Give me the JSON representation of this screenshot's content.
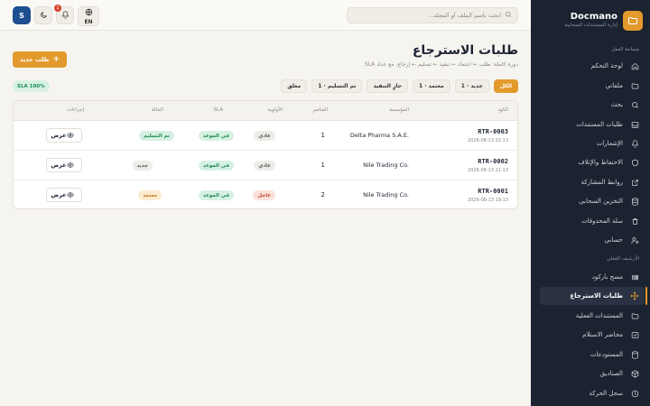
{
  "brand": {
    "name": "Docmano",
    "subtitle": "إدارة المستندات السحابية"
  },
  "sidebar": {
    "workspace_label": "مساحة العمل",
    "archive_label": "الأرشيف الفعلي",
    "items": [
      {
        "label": "لوحة التحكم",
        "icon": "home-icon"
      },
      {
        "label": "ملفاتي",
        "icon": "folder-icon"
      },
      {
        "label": "بحث",
        "icon": "search-icon"
      },
      {
        "label": "طلبات المستندات",
        "icon": "inbox-icon"
      },
      {
        "label": "الإشعارات",
        "icon": "bell-icon"
      },
      {
        "label": "الاحتفاظ والإتلاف",
        "icon": "shield-icon"
      },
      {
        "label": "روابط المشاركة",
        "icon": "external-link-icon"
      },
      {
        "label": "التخزين السحابي",
        "icon": "database-icon"
      },
      {
        "label": "سلة المحذوفات",
        "icon": "trash-icon"
      },
      {
        "label": "حسابي",
        "icon": "user-cog-icon"
      }
    ],
    "archive_items": [
      {
        "label": "مسح باركود",
        "icon": "barcode-icon"
      },
      {
        "label": "طلبات الاسترجاع",
        "icon": "move-icon",
        "active": true
      },
      {
        "label": "المستندات الفعلية",
        "icon": "folder-icon"
      },
      {
        "label": "محاضر الاستلام",
        "icon": "checklist-icon"
      },
      {
        "label": "المستودعات",
        "icon": "warehouse-icon"
      },
      {
        "label": "الصناديق",
        "icon": "box-icon"
      },
      {
        "label": "سجل الحركة",
        "icon": "clock-icon"
      }
    ]
  },
  "topbar": {
    "search_placeholder": "ابحث باسم الملف أو المجلد...",
    "language": "EN",
    "notification_count": "1",
    "avatar_initial": "S"
  },
  "page": {
    "title": "طلبات الاسترجاع",
    "subtitle": "دورة كاملة: طلب ← اعتماد ← تنفيذ ← تسليم ← إرجاع، مع عداد SLA",
    "new_button": "طلب جديد",
    "sla_label": "SLA 100%"
  },
  "filters": [
    {
      "label": "الكل",
      "active": true
    },
    {
      "label": "جديد · 1"
    },
    {
      "label": "معتمد · 1"
    },
    {
      "label": "جارٍ التنفيذ"
    },
    {
      "label": "تم التسليم · 1"
    },
    {
      "label": "مغلق"
    }
  ],
  "table": {
    "headers": {
      "code": "الكود",
      "org": "المؤسسة",
      "items": "العناصر",
      "priority": "الأولوية",
      "sla": "SLA",
      "status": "الحالة",
      "actions": "إجراءات"
    },
    "rows": [
      {
        "code": "RTR-0003",
        "date": "2026-08-13 22:13",
        "org": "Delta Pharma S.A.E.",
        "items": "1",
        "priority": "عادي",
        "priority_type": "normal",
        "sla": "في الموعد",
        "status": "تم التسليم",
        "status_type": "delivered",
        "action": "عرض"
      },
      {
        "code": "RTR-0002",
        "date": "2026-08-13 21:13",
        "org": "Nile Trading Co.",
        "items": "1",
        "priority": "عادي",
        "priority_type": "normal",
        "sla": "في الموعد",
        "status": "جديد",
        "status_type": "new",
        "action": "عرض"
      },
      {
        "code": "RTR-0001",
        "date": "2026-08-13 19:13",
        "org": "Nile Trading Co.",
        "items": "2",
        "priority": "عاجل",
        "priority_type": "urgent",
        "sla": "في الموعد",
        "status": "معتمد",
        "status_type": "approved",
        "action": "عرض"
      }
    ]
  },
  "colors": {
    "accent": "#e39a2d",
    "sidebar_bg": "#1b2230",
    "success": "#1e8a55",
    "danger": "#c2452f"
  }
}
